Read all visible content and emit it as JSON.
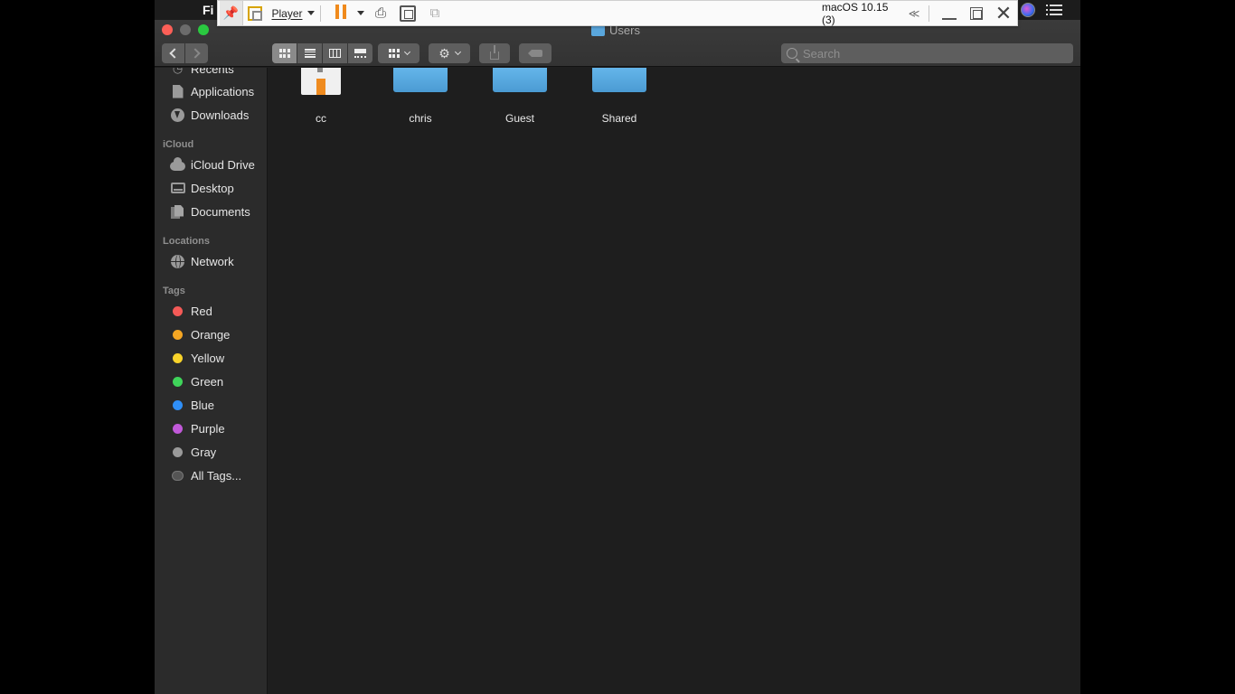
{
  "menubar": {
    "app_name_partial": "Fi"
  },
  "vm_toolbar": {
    "menu_label": "Player",
    "vm_title": "macOS 10.15 (3)",
    "collapse_glyph": "≪"
  },
  "finder": {
    "window_title": "Users",
    "search": {
      "placeholder": "Search",
      "value": ""
    },
    "sidebar": {
      "favorites": [
        {
          "label": "Recents",
          "icon": "clock-icon"
        },
        {
          "label": "Applications",
          "icon": "applications-icon"
        },
        {
          "label": "Downloads",
          "icon": "downloads-icon"
        }
      ],
      "icloud_header": "iCloud",
      "icloud": [
        {
          "label": "iCloud Drive",
          "icon": "cloud-icon"
        },
        {
          "label": "Desktop",
          "icon": "desktop-icon"
        },
        {
          "label": "Documents",
          "icon": "documents-icon"
        }
      ],
      "locations_header": "Locations",
      "locations": [
        {
          "label": "Network",
          "icon": "globe-icon"
        }
      ],
      "tags_header": "Tags",
      "tags": [
        {
          "label": "Red",
          "color": "#f45a57"
        },
        {
          "label": "Orange",
          "color": "#f5a623"
        },
        {
          "label": "Yellow",
          "color": "#f8d32a"
        },
        {
          "label": "Green",
          "color": "#3fd45a"
        },
        {
          "label": "Blue",
          "color": "#2f8ff7"
        },
        {
          "label": "Purple",
          "color": "#c159d9"
        },
        {
          "label": "Gray",
          "color": "#9a9a9a"
        },
        {
          "label": "All Tags...",
          "color": ""
        }
      ]
    },
    "items": [
      {
        "label": "cc",
        "type": "home-folder"
      },
      {
        "label": "chris",
        "type": "folder"
      },
      {
        "label": "Guest",
        "type": "folder"
      },
      {
        "label": "Shared",
        "type": "folder"
      }
    ]
  }
}
